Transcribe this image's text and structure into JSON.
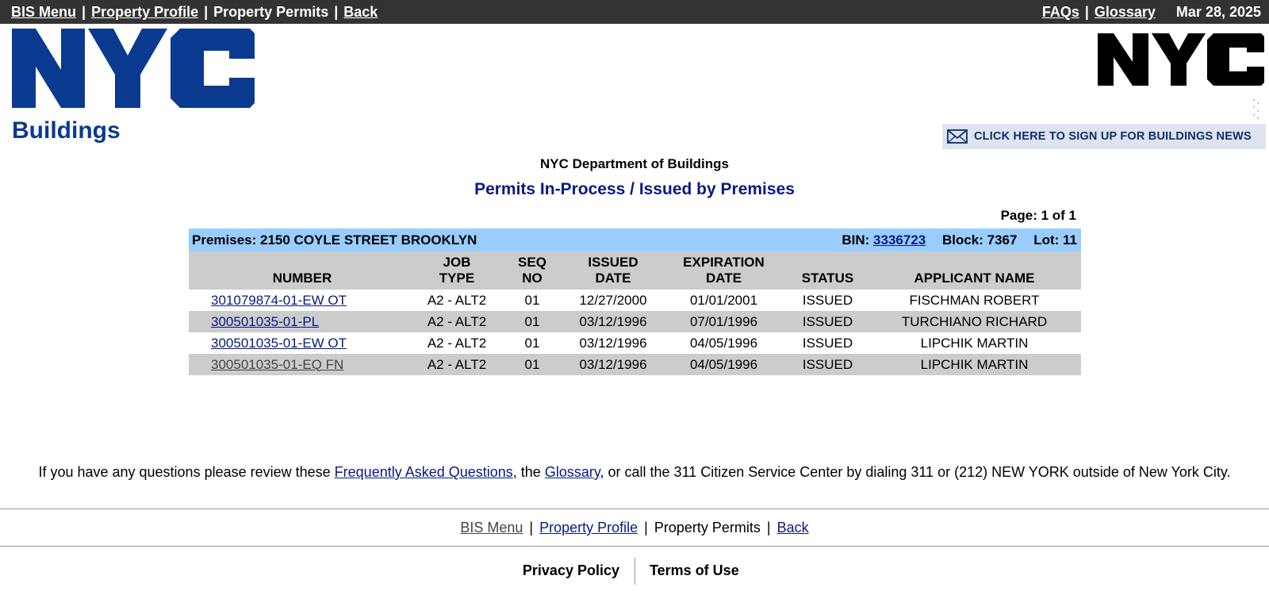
{
  "topbar": {
    "bis_menu": "BIS Menu",
    "property_profile": "Property Profile",
    "property_permits": "Property Permits",
    "back": "Back",
    "faqs": "FAQs",
    "glossary": "Glossary",
    "date": "Mar 28, 2025",
    "separator": "|"
  },
  "logos": {
    "left_buildings_text": "Buildings",
    "left_logo_text": "NYC",
    "right_logo_text": "NYC"
  },
  "news_banner": {
    "label": "CLICK HERE TO SIGN UP FOR BUILDINGS NEWS"
  },
  "header": {
    "department": "NYC Department of Buildings",
    "title": "Permits In-Process / Issued by Premises",
    "page_info": "Page: 1 of 1"
  },
  "premises": {
    "address": "Premises: 2150 COYLE STREET BROOKLYN",
    "bin_label": "BIN:",
    "bin": "3336723",
    "block": "Block: 7367",
    "lot": "Lot: 11"
  },
  "table": {
    "columns": [
      {
        "line1": "",
        "line2": "NUMBER"
      },
      {
        "line1": "JOB",
        "line2": "TYPE"
      },
      {
        "line1": "SEQ",
        "line2": "NO"
      },
      {
        "line1": "ISSUED",
        "line2": "DATE"
      },
      {
        "line1": "EXPIRATION",
        "line2": "DATE"
      },
      {
        "line1": "",
        "line2": "STATUS"
      },
      {
        "line1": "",
        "line2": "APPLICANT NAME"
      }
    ],
    "rows": [
      {
        "number": "301079874-01-EW OT",
        "job_type": "A2 - ALT2",
        "seq": "01",
        "issued": "12/27/2000",
        "expiration": "01/01/2001",
        "status": "ISSUED",
        "applicant": "FISCHMAN ROBERT"
      },
      {
        "number": "300501035-01-PL",
        "job_type": "A2 - ALT2",
        "seq": "01",
        "issued": "03/12/1996",
        "expiration": "07/01/1996",
        "status": "ISSUED",
        "applicant": "TURCHIANO RICHARD"
      },
      {
        "number": "300501035-01-EW OT",
        "job_type": "A2 - ALT2",
        "seq": "01",
        "issued": "03/12/1996",
        "expiration": "04/05/1996",
        "status": "ISSUED",
        "applicant": "LIPCHIK MARTIN"
      },
      {
        "number": "300501035-01-EQ FN",
        "job_type": "A2 - ALT2",
        "seq": "01",
        "issued": "03/12/1996",
        "expiration": "04/05/1996",
        "status": "ISSUED",
        "applicant": "LIPCHIK MARTIN"
      }
    ]
  },
  "help": {
    "text1": "If you have any questions please review these ",
    "faq_link": "Frequently Asked Questions",
    "text2": ", the ",
    "glossary_link": "Glossary",
    "text3": ", or call the 311 Citizen Service Center by dialing 311 or (212) NEW YORK outside of New York City."
  },
  "bottomnav": {
    "bis_menu": "BIS Menu",
    "property_profile": "Property Profile",
    "property_permits": "Property Permits",
    "back": "Back",
    "separator": "|"
  },
  "legal": {
    "privacy": "Privacy Policy",
    "terms": "Terms of Use"
  },
  "colors": {
    "topbar_bg": "#333333",
    "premises_bg": "#99ccff",
    "header_row_bg": "#cccccc",
    "link": "#0a1a80",
    "logo_blue": "#0a3a8f"
  }
}
